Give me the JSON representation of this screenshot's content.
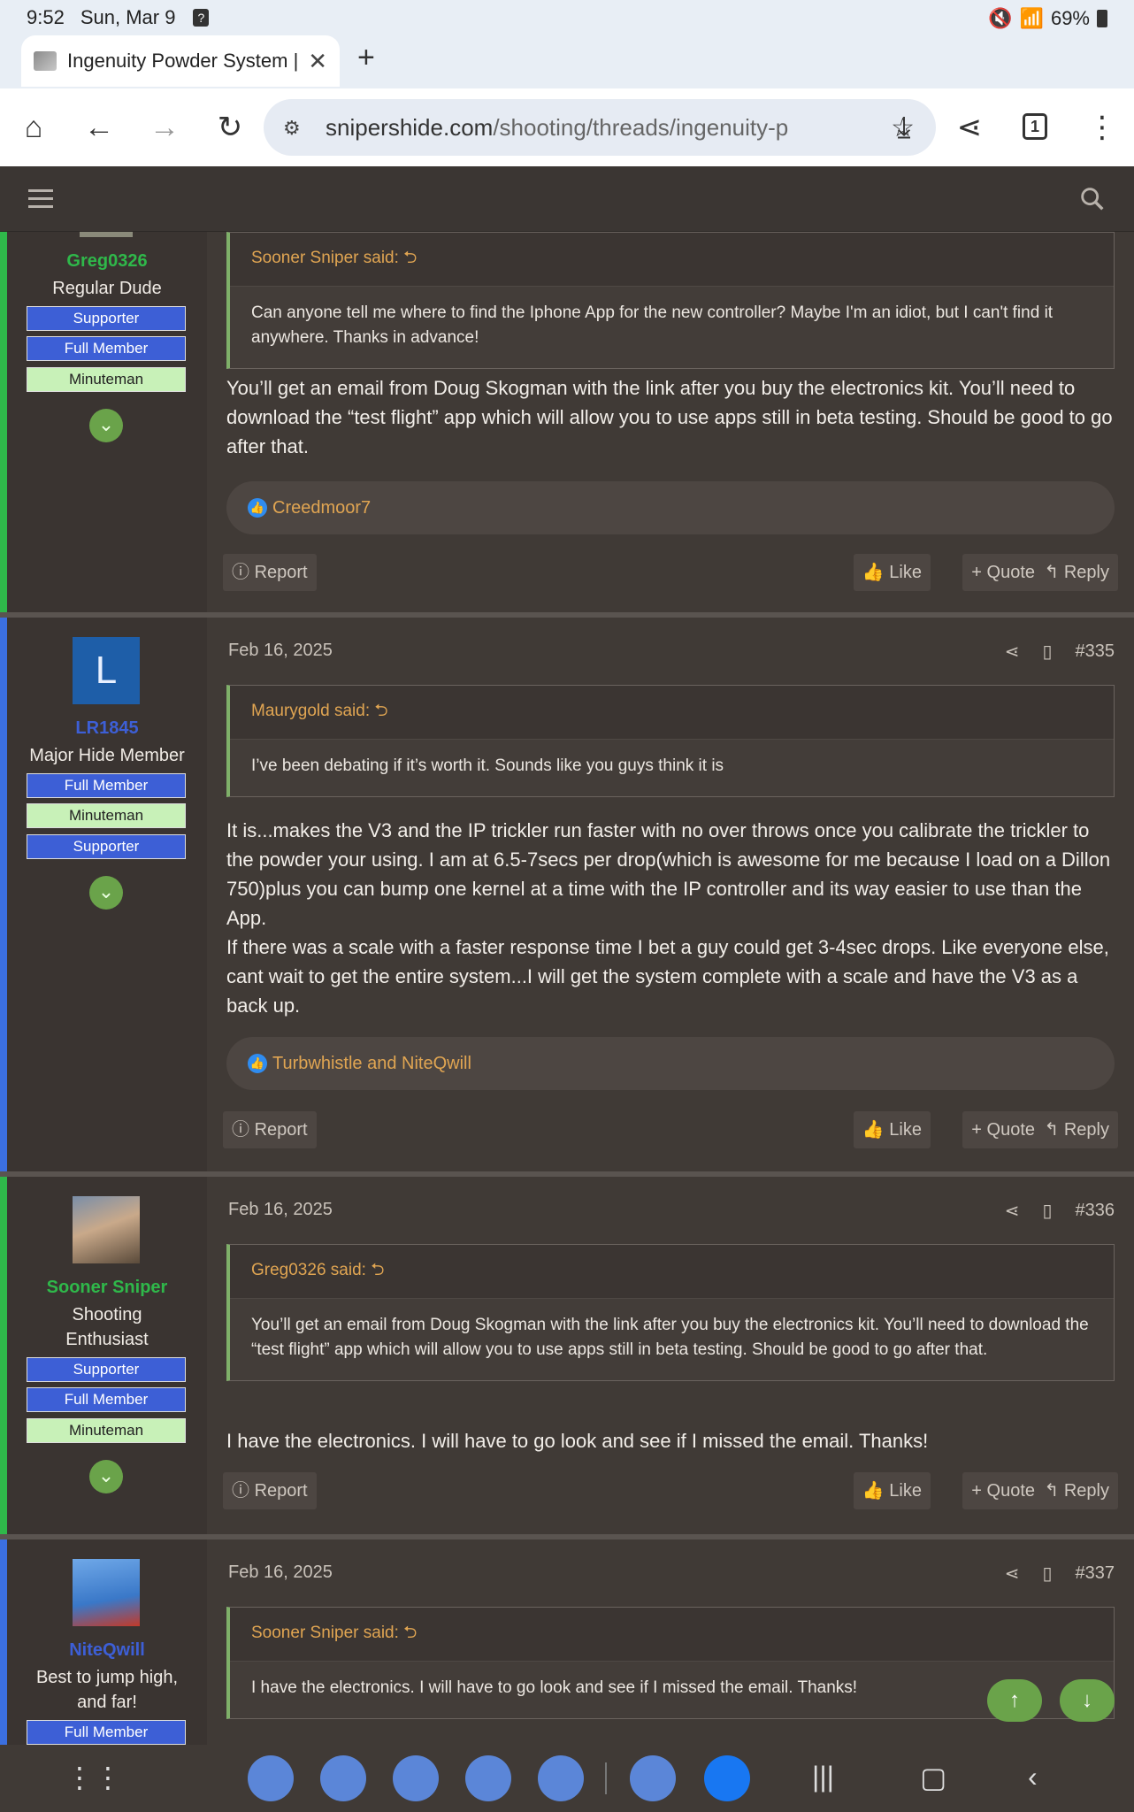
{
  "status_bar": {
    "time": "9:52",
    "date": "Sun, Mar 9",
    "notif": "?",
    "battery": "69%"
  },
  "browser": {
    "tab_title": "Ingenuity Powder System | P",
    "url_host": "snipershide.com",
    "url_path": "/shooting/threads/ingenuity-p",
    "tab_count": "1"
  },
  "actions": {
    "report": "Report",
    "like": "Like",
    "quote": "Quote",
    "reply": "Reply"
  },
  "posts": [
    {
      "user": {
        "name": "Greg0326",
        "title": "Regular Dude",
        "badges": [
          "Supporter",
          "Full Member",
          "Minuteman"
        ]
      },
      "quote": {
        "author": "Sooner Sniper said:",
        "text": "Can anyone tell me where to find the Iphone App for the new controller? Maybe I'm an idiot, but I can't find it anywhere. Thanks in advance!"
      },
      "body": "You’ll get an email from Doug Skogman with the link after you buy the electronics kit. You’ll need to download the “test flight” app which will allow you to use apps still in beta testing. Should be good to go after that.",
      "reactions": "Creedmoor7"
    },
    {
      "date": "Feb 16, 2025",
      "number": "#335",
      "user": {
        "name": "LR1845",
        "avatar_letter": "L",
        "title": "Major Hide Member",
        "badges": [
          "Full Member",
          "Minuteman",
          "Supporter"
        ]
      },
      "quote": {
        "author": "Maurygold said:",
        "text": "I’ve been debating if it’s worth it. Sounds like you guys think it is"
      },
      "body": "It is...makes the V3 and the IP trickler run faster with no over throws once you calibrate the trickler to the powder your using. I am at 6.5-7secs per drop(which is awesome for me because I load on a Dillon 750)plus you can bump one kernel at a time with the IP controller and its way easier to use than the App.",
      "body2": "If there was a scale with a faster response time I bet a guy could get 3-4sec drops. Like everyone else, cant wait to get the entire system...I will get the system complete with a scale and have the V3 as a back up.",
      "reactions": "Turbwhistle and NiteQwill"
    },
    {
      "date": "Feb 16, 2025",
      "number": "#336",
      "user": {
        "name": "Sooner Sniper",
        "title": "Shooting Enthusiast",
        "badges": [
          "Supporter",
          "Full Member",
          "Minuteman"
        ]
      },
      "quote": {
        "author": "Greg0326 said:",
        "text": "You’ll get an email from Doug Skogman with the link after you buy the electronics kit. You’ll need to download the “test flight” app which will allow you to use apps still in beta testing. Should be good to go after that."
      },
      "body": "I have the electronics. I will have to go look and see if I missed the email. Thanks!"
    },
    {
      "date": "Feb 16, 2025",
      "number": "#337",
      "user": {
        "name": "NiteQwill",
        "title": "Best to jump high, and far!",
        "badges": [
          "Full Member"
        ]
      },
      "quote": {
        "author": "Sooner Sniper said:",
        "text": "I have the electronics. I will have to go look and see if I missed the email. Thanks!"
      }
    }
  ],
  "colors": {
    "accent_green": "#6aa34a",
    "link_orange": "#e0a552",
    "badge_blue": "#3d5fd6",
    "badge_green": "#c8f1b8"
  }
}
